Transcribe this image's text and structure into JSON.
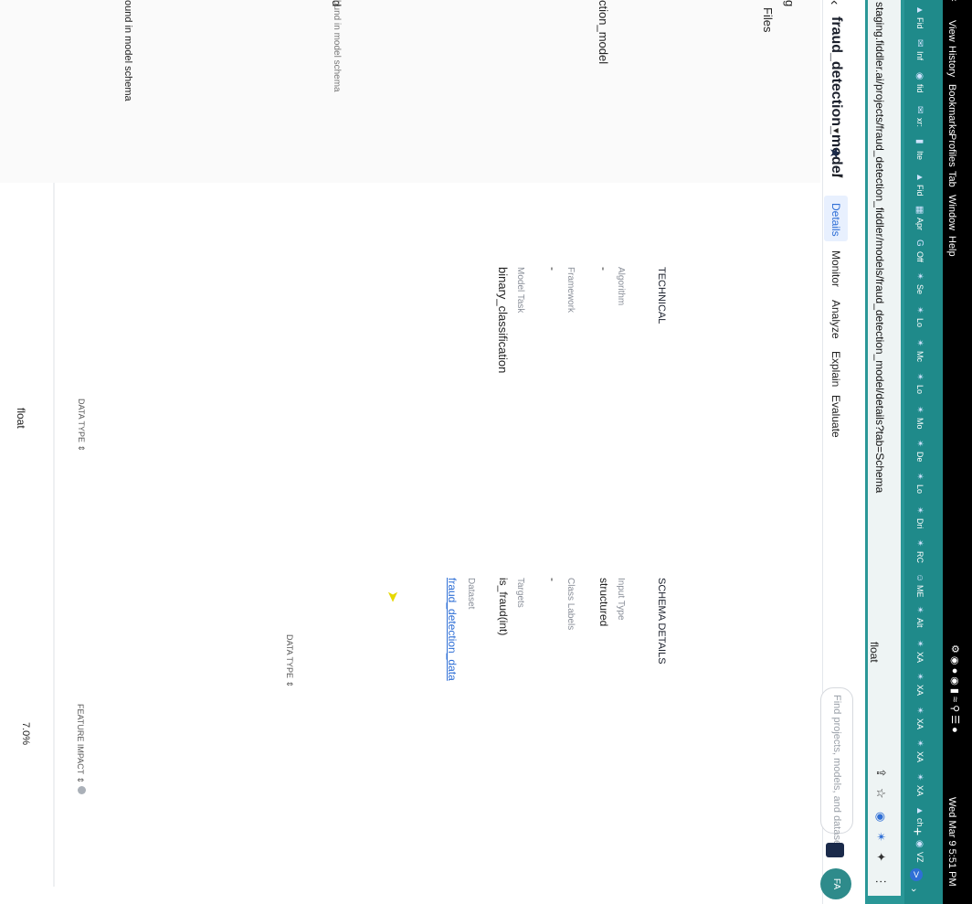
{
  "menubar": {
    "items": [
      "View",
      "History",
      "Bookmarks",
      "Profiles",
      "Tab",
      "Window",
      "Help"
    ],
    "datetime": "Wed Mar 9  5:51 PM"
  },
  "bookmarks": [
    {
      "label": "Fid",
      "icon": "shield-icon"
    },
    {
      "label": "Inf",
      "icon": "mail-icon"
    },
    {
      "label": "fid",
      "icon": "github-icon"
    },
    {
      "label": "xr:",
      "icon": "mail-icon"
    },
    {
      "label": "Ite",
      "icon": "slides-icon"
    },
    {
      "label": "Fid",
      "icon": "shield-icon"
    },
    {
      "label": "Apr",
      "icon": "calendar-icon"
    },
    {
      "label": "Off",
      "icon": "google-icon"
    },
    {
      "label": "Se",
      "icon": "gear-icon"
    },
    {
      "label": "Lo",
      "icon": "gear-icon"
    },
    {
      "label": "Mc",
      "icon": "gear-icon"
    },
    {
      "label": "Lo",
      "icon": "gear-icon"
    },
    {
      "label": "Mo",
      "icon": "gear-icon"
    },
    {
      "label": "De",
      "icon": "gear-icon"
    },
    {
      "label": "Lo",
      "icon": "gear-icon"
    },
    {
      "label": "Dri",
      "icon": "gear-icon"
    },
    {
      "label": "RC",
      "icon": "gear-icon"
    },
    {
      "label": "ME",
      "icon": "face-icon"
    },
    {
      "label": "Alt",
      "icon": "gear-icon"
    },
    {
      "label": "XA",
      "icon": "gear-icon"
    },
    {
      "label": "XA",
      "icon": "gear-icon"
    },
    {
      "label": "XA",
      "icon": "gear-icon"
    },
    {
      "label": "XA",
      "icon": "gear-icon"
    },
    {
      "label": "XA",
      "icon": "gear-icon"
    },
    {
      "label": "ch",
      "icon": "shield-icon"
    },
    {
      "label": "VZ",
      "icon": "github-icon"
    }
  ],
  "address_bar": {
    "url": "staging.fiddler.ai/projects/fraud_detection_fiddler/models/fraud_detection_model/details?tab=Schema"
  },
  "header": {
    "model_title": "fraud_detection_model",
    "search_placeholder": "Find projects, models, and datasets",
    "avatar_initials": "FA"
  },
  "tabs": [
    "Details",
    "Monitor",
    "Analyze",
    "Explain",
    "Evaluate"
  ],
  "left_panel": {
    "files_label": "Files",
    "model_name_fragment": "ction_model",
    "g_fragment": "g",
    "d_fragment": "d",
    "note1": "bund in model schema",
    "note2": "ound in model schema"
  },
  "technical": {
    "title": "TECHNICAL",
    "algorithm_label": "Algorithm",
    "algorithm_value": "-",
    "framework_label": "Framework",
    "framework_value": "-",
    "model_task_label": "Model Task",
    "model_task_value": "binary_classification"
  },
  "schema_details": {
    "title": "SCHEMA DETAILS",
    "input_type_label": "Input Type",
    "input_type_value": "structured",
    "class_labels_label": "Class Labels",
    "class_labels_value": "-",
    "targets_label": "Targets",
    "targets_value": "is_fraud(int)",
    "dataset_label": "Dataset",
    "dataset_value": "fraud_detection_data"
  },
  "table": {
    "data_type_header": "DATA TYPE",
    "feature_impact_header": "FEATURE IMPACT",
    "row1_data_type": "float",
    "row2_data_type": "float",
    "row2_feature_impact": "7.0%"
  },
  "colors": {
    "menubar": "#000000",
    "toolbar": "#1f8a8a",
    "accent": "#2f6fd6",
    "avatar": "#2e8b8b"
  }
}
